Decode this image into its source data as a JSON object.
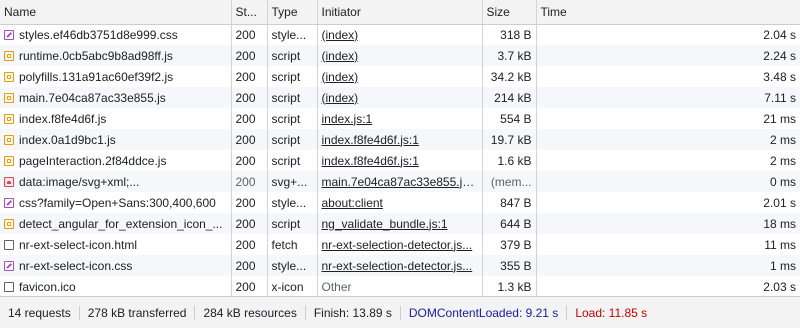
{
  "columns": {
    "name": "Name",
    "status": "St...",
    "type": "Type",
    "initiator": "Initiator",
    "size": "Size",
    "time": "Time"
  },
  "rows": [
    {
      "icon": "css-file-icon",
      "name": "styles.ef46db3751d8e999.css",
      "status": "200",
      "type": "style...",
      "initiator": "(index)",
      "initiator_link": true,
      "size": "318 B",
      "time": "2.04 s"
    },
    {
      "icon": "js-file-icon",
      "name": "runtime.0cb5abc9b8ad98ff.js",
      "status": "200",
      "type": "script",
      "initiator": "(index)",
      "initiator_link": true,
      "size": "3.7 kB",
      "time": "2.24 s"
    },
    {
      "icon": "js-file-icon",
      "name": "polyfills.131a91ac60ef39f2.js",
      "status": "200",
      "type": "script",
      "initiator": "(index)",
      "initiator_link": true,
      "size": "34.2 kB",
      "time": "3.48 s"
    },
    {
      "icon": "js-file-icon",
      "name": "main.7e04ca87ac33e855.js",
      "status": "200",
      "type": "script",
      "initiator": "(index)",
      "initiator_link": true,
      "size": "214 kB",
      "time": "7.11 s"
    },
    {
      "icon": "js-file-icon",
      "name": "index.f8fe4d6f.js",
      "status": "200",
      "type": "script",
      "initiator": "index.js:1",
      "initiator_link": true,
      "size": "554 B",
      "time": "21 ms"
    },
    {
      "icon": "js-file-icon",
      "name": "index.0a1d9bc1.js",
      "status": "200",
      "type": "script",
      "initiator": "index.f8fe4d6f.js:1",
      "initiator_link": true,
      "size": "19.7 kB",
      "time": "2 ms"
    },
    {
      "icon": "js-file-icon",
      "name": "pageInteraction.2f84ddce.js",
      "status": "200",
      "type": "script",
      "initiator": "index.f8fe4d6f.js:1",
      "initiator_link": true,
      "size": "1.6 kB",
      "time": "2 ms"
    },
    {
      "icon": "image-file-icon",
      "name": "data:image/svg+xml;...",
      "status": "200",
      "status_muted": true,
      "type": "svg+...",
      "initiator": "main.7e04ca87ac33e855.js:1",
      "initiator_link": true,
      "size": "(mem...",
      "size_muted": true,
      "time": "0 ms"
    },
    {
      "icon": "css-file-icon",
      "name": "css?family=Open+Sans:300,400,600",
      "status": "200",
      "type": "style...",
      "initiator": "about:client",
      "initiator_link": true,
      "size": "847 B",
      "time": "2.01 s"
    },
    {
      "icon": "js-file-icon",
      "name": "detect_angular_for_extension_icon_...",
      "status": "200",
      "type": "script",
      "initiator": "ng_validate_bundle.js:1",
      "initiator_link": true,
      "size": "644 B",
      "time": "18 ms"
    },
    {
      "icon": "document-file-icon",
      "name": "nr-ext-select-icon.html",
      "status": "200",
      "type": "fetch",
      "initiator": "nr-ext-selection-detector.js...",
      "initiator_link": true,
      "size": "379 B",
      "time": "11 ms"
    },
    {
      "icon": "css-file-icon",
      "name": "nr-ext-select-icon.css",
      "status": "200",
      "type": "style...",
      "initiator": "nr-ext-selection-detector.js...",
      "initiator_link": true,
      "size": "355 B",
      "time": "1 ms"
    },
    {
      "icon": "document-file-icon",
      "name": "favicon.ico",
      "status": "200",
      "type": "x-icon",
      "initiator": "Other",
      "initiator_link": false,
      "size": "1.3 kB",
      "time": "2.03 s"
    }
  ],
  "summary": {
    "requests": "14 requests",
    "transferred": "278 kB transferred",
    "resources": "284 kB resources",
    "finish": "Finish: 13.89 s",
    "dom_content_loaded": "DOMContentLoaded: 9.21 s",
    "load": "Load: 11.85 s"
  },
  "colors": {
    "dom_content_loaded": "#1a1aa6",
    "load": "#c80000"
  }
}
